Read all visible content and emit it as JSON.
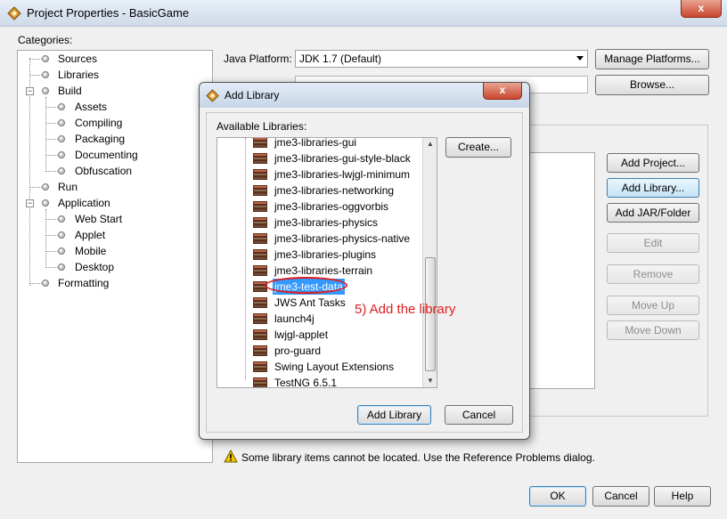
{
  "window": {
    "title": "Project Properties - BasicGame",
    "close_label": "x"
  },
  "categories": {
    "label": "Categories:",
    "items": [
      {
        "label": "Sources"
      },
      {
        "label": "Libraries"
      },
      {
        "label": "Build"
      },
      {
        "label": "Assets"
      },
      {
        "label": "Compiling"
      },
      {
        "label": "Packaging"
      },
      {
        "label": "Documenting"
      },
      {
        "label": "Obfuscation"
      },
      {
        "label": "Run"
      },
      {
        "label": "Application"
      },
      {
        "label": "Web Start"
      },
      {
        "label": "Applet"
      },
      {
        "label": "Mobile"
      },
      {
        "label": "Desktop"
      },
      {
        "label": "Formatting"
      }
    ]
  },
  "libraries_panel": {
    "java_platform_label": "Java Platform:",
    "java_platform_value": "JDK 1.7 (Default)",
    "manage_platforms_button": "Manage Platforms...",
    "browse_button": "Browse...",
    "side_buttons": {
      "add_project": "Add Project...",
      "add_library": "Add Library...",
      "add_jar": "Add JAR/Folder",
      "edit": "Edit",
      "remove": "Remove",
      "move_up": "Move Up",
      "move_down": "Move Down"
    }
  },
  "warning": {
    "icon": "warning-icon",
    "text": "Some library items cannot be located. Use the Reference Problems dialog."
  },
  "footer": {
    "ok": "OK",
    "cancel": "Cancel",
    "help": "Help"
  },
  "dialog": {
    "title": "Add Library",
    "close_label": "x",
    "available_label": "Available Libraries:",
    "create_button": "Create...",
    "add_button": "Add Library",
    "cancel_button": "Cancel",
    "libraries": [
      {
        "label": "jme3-libraries-gui"
      },
      {
        "label": "jme3-libraries-gui-style-black"
      },
      {
        "label": "jme3-libraries-lwjgl-minimum"
      },
      {
        "label": "jme3-libraries-networking"
      },
      {
        "label": "jme3-libraries-oggvorbis"
      },
      {
        "label": "jme3-libraries-physics"
      },
      {
        "label": "jme3-libraries-physics-native"
      },
      {
        "label": "jme3-libraries-plugins"
      },
      {
        "label": "jme3-libraries-terrain"
      },
      {
        "label": "jme3-test-data"
      },
      {
        "label": "JWS Ant Tasks"
      },
      {
        "label": "launch4j"
      },
      {
        "label": "lwjgl-applet"
      },
      {
        "label": "pro-guard"
      },
      {
        "label": "Swing Layout Extensions"
      },
      {
        "label": "TestNG 6.5.1"
      }
    ],
    "selected_library": "jme3-test-data"
  },
  "annotation": {
    "text": "5) Add the library",
    "color": "#e01d1d"
  },
  "colors": {
    "selection": "#3399ff",
    "annotation": "#e01d1d"
  }
}
